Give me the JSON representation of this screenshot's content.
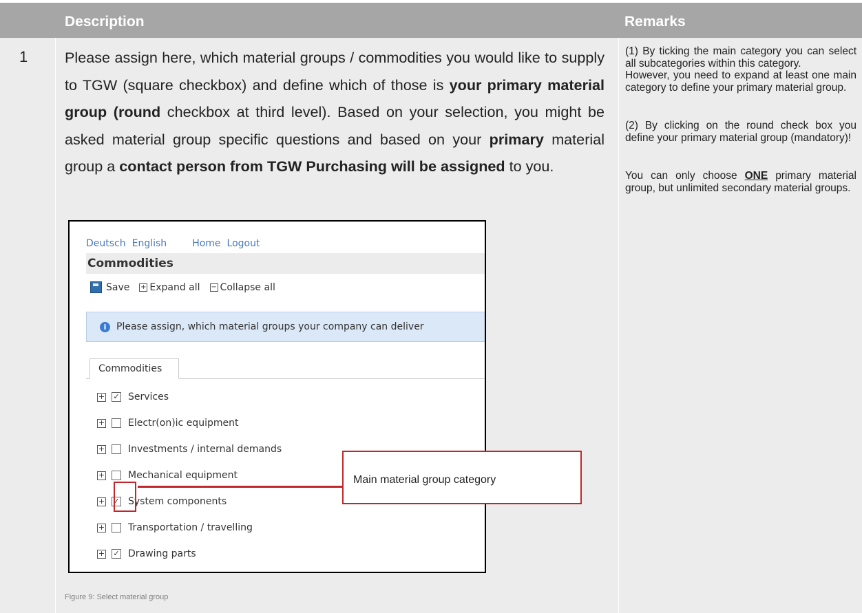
{
  "header": {
    "description": "Description",
    "remarks": "Remarks"
  },
  "row": {
    "number": "1",
    "description_parts": {
      "p1": "Please assign here, which material groups / commodities you would like to supply to TGW (square checkbox) and define which of those is ",
      "b1": "your primary material group (round",
      "p2": " checkbox at third level). Based on your selection, you might be asked material group specific questions and based on your ",
      "b2": "primary",
      "p3": " material group a ",
      "b3": "contact person from TGW Purchasing will be assigned",
      "p4": " to you."
    },
    "remarks": {
      "r1a": "(1) By ticking the main category you can select all subcategories within this category.",
      "r1b": "However, you need to expand at least one main category to define your primary material group.",
      "r2": "(2) By clicking on the round check box you define your primary material group (mandatory)!",
      "r3_pre": "You can only choose ",
      "r3_bold": "ONE",
      "r3_post": " primary material group, but unlimited secondary material groups."
    }
  },
  "screenshot": {
    "nav": [
      "Deutsch",
      "English",
      "Home",
      "Logout"
    ],
    "title": "Commodities",
    "toolbar": {
      "save": "Save",
      "expand": "Expand all",
      "collapse": "Collapse all"
    },
    "info": "Please assign, which material groups your company can deliver",
    "tab": "Commodities",
    "tree": [
      {
        "label": "Services",
        "checked": true
      },
      {
        "label": "Electr(on)ic equipment",
        "checked": false
      },
      {
        "label": "Investments / internal demands",
        "checked": false
      },
      {
        "label": "Mechanical equipment",
        "checked": false
      },
      {
        "label": "System components",
        "checked": true
      },
      {
        "label": "Transportation / travelling",
        "checked": false
      },
      {
        "label": "Drawing parts",
        "checked": true
      }
    ]
  },
  "callout": "Main material group category",
  "caption": "Figure 9: Select material group",
  "colors": {
    "header_bg": "#a6a6a6",
    "row_bg": "#ececec",
    "callout_red": "#c0272d",
    "link_blue": "#4a78b8"
  }
}
